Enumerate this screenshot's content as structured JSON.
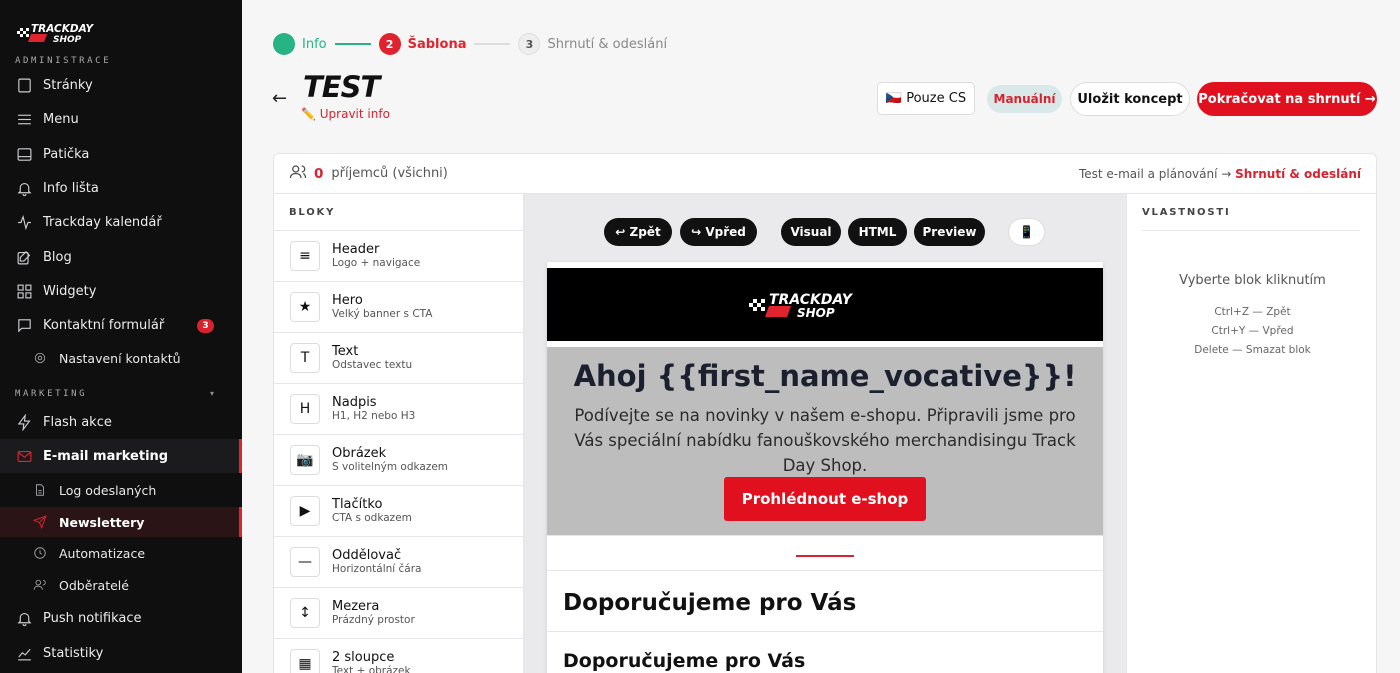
{
  "brand": {
    "logo_text_top": "TRACKDAY",
    "logo_text_bottom": "SHOP",
    "accent": "#e0242f",
    "success": "#27b384"
  },
  "sidebar": {
    "admin_label": "ADMINISTRACE",
    "items_top": [
      {
        "label": "Stránky",
        "icon": "page-icon"
      },
      {
        "label": "Menu",
        "icon": "menu-icon"
      },
      {
        "label": "Patička",
        "icon": "footer-icon"
      },
      {
        "label": "Info lišta",
        "icon": "bell-icon"
      },
      {
        "label": "Trackday kalendář",
        "icon": "activity-icon"
      },
      {
        "label": "Blog",
        "icon": "edit-icon"
      },
      {
        "label": "Widgety",
        "icon": "widgets-icon"
      },
      {
        "label": "Kontaktní formulář",
        "icon": "message-icon",
        "badge": "3"
      }
    ],
    "contact_sub": {
      "label": "Nastavení kontaktů",
      "icon": "gear-icon"
    },
    "marketing_label": "MARKETING",
    "marketing_chevron": "▾",
    "items_marketing": [
      {
        "label": "Flash akce",
        "icon": "zap-icon"
      },
      {
        "label": "E-mail marketing",
        "icon": "mail-icon"
      }
    ],
    "email_subs": [
      {
        "label": "Log odeslaných",
        "icon": "file-icon"
      },
      {
        "label": "Newslettery",
        "icon": "send-icon"
      },
      {
        "label": "Automatizace",
        "icon": "clock-icon"
      },
      {
        "label": "Odběratelé",
        "icon": "users-icon"
      }
    ],
    "items_bottom": [
      {
        "label": "Push notifikace",
        "icon": "bell-icon"
      },
      {
        "label": "Statistiky",
        "icon": "chart-icon"
      }
    ]
  },
  "stepper": {
    "steps": [
      {
        "num": "",
        "label": "Info"
      },
      {
        "num": "2",
        "label": "Šablona"
      },
      {
        "num": "3",
        "label": "Shrnutí & odeslání"
      }
    ]
  },
  "header": {
    "back": "←",
    "title": "TEST",
    "edit_info": "✏️ Upravit info",
    "lang_button": "🇨🇿 Pouze CS",
    "manual_button": "Manuální",
    "draft_button": "Uložit koncept",
    "continue_button": "Pokračovat na shrnutí →"
  },
  "recipients": {
    "count": "0",
    "label": "příjemců (všichni)",
    "right_text": "Test e-mail a plánování →",
    "right_link": "Shrnutí & odeslání"
  },
  "blocks": {
    "heading": "BLOKY",
    "items": [
      {
        "icon": "≡",
        "name": "Header",
        "desc": "Logo + navigace"
      },
      {
        "icon": "★",
        "name": "Hero",
        "desc": "Velký banner s CTA"
      },
      {
        "icon": "T",
        "name": "Text",
        "desc": "Odstavec textu"
      },
      {
        "icon": "H",
        "name": "Nadpis",
        "desc": "H1, H2 nebo H3"
      },
      {
        "icon": "📷",
        "name": "Obrázek",
        "desc": "S volitelným odkazem"
      },
      {
        "icon": "▶",
        "name": "Tlačítko",
        "desc": "CTA s odkazem"
      },
      {
        "icon": "—",
        "name": "Oddělovač",
        "desc": "Horizontální čára"
      },
      {
        "icon": "↕",
        "name": "Mezera",
        "desc": "Prázdný prostor"
      },
      {
        "icon": "▦",
        "name": "2 sloupce",
        "desc": "Text + obrázek"
      }
    ]
  },
  "toolbar": {
    "undo": "↩ Zpět",
    "redo": "↪ Vpřed",
    "visual": "Visual",
    "html": "HTML",
    "preview": "Preview",
    "mobile": "📱"
  },
  "email": {
    "hero_title": "Ahoj {{first_name_vocative}}!",
    "hero_text": "Podívejte se na novinky v našem e-shopu. Připravili jsme pro Vás speciální nabídku fanouškovského merchandisingu Track Day Shop.",
    "cta": "Prohlédnout e-shop",
    "heading1": "Doporučujeme pro Vás",
    "heading2": "Doporučujeme pro Vás"
  },
  "properties": {
    "heading": "VLASTNOSTI",
    "hint": "Vyberte blok kliknutím",
    "shortcuts": [
      "Ctrl+Z — Zpět",
      "Ctrl+Y — Vpřed",
      "Delete — Smazat blok"
    ]
  }
}
